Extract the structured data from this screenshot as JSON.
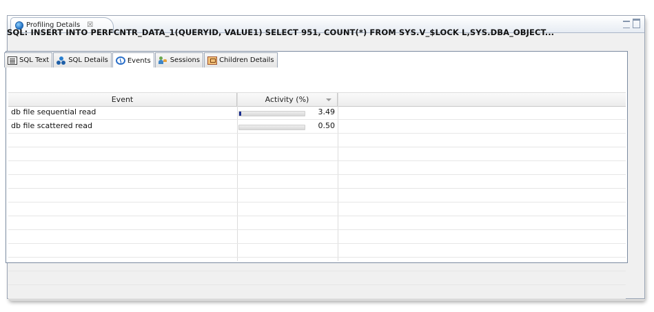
{
  "view": {
    "tab_title": "Profiling Details",
    "close_glyph": "☒"
  },
  "sql_title": "SQL: INSERT INTO PERFCNTR_DATA_1(QUERYID, VALUE1) SELECT 951, COUNT(*) FROM SYS.V_$LOCK L,SYS.DBA_OBJECT...",
  "tabs": [
    {
      "label": "SQL Text",
      "icon": "sql-text-icon"
    },
    {
      "label": "SQL Details",
      "icon": "sql-details-icon"
    },
    {
      "label": "Events",
      "icon": "events-clock-icon",
      "active": true
    },
    {
      "label": "Sessions",
      "icon": "sessions-icon"
    },
    {
      "label": "Children Details",
      "icon": "children-details-icon"
    }
  ],
  "table": {
    "columns": {
      "event": "Event",
      "activity": "Activity (%)"
    },
    "rows": [
      {
        "event": "db file sequential read",
        "activity": "3.49",
        "activity_fraction": 0.0349
      },
      {
        "event": "db file scattered read",
        "activity": "0.50",
        "activity_fraction": 0.005
      }
    ]
  },
  "colors": {
    "bar_fill": "#1a2e8f",
    "accent": "#2a6fc9"
  }
}
